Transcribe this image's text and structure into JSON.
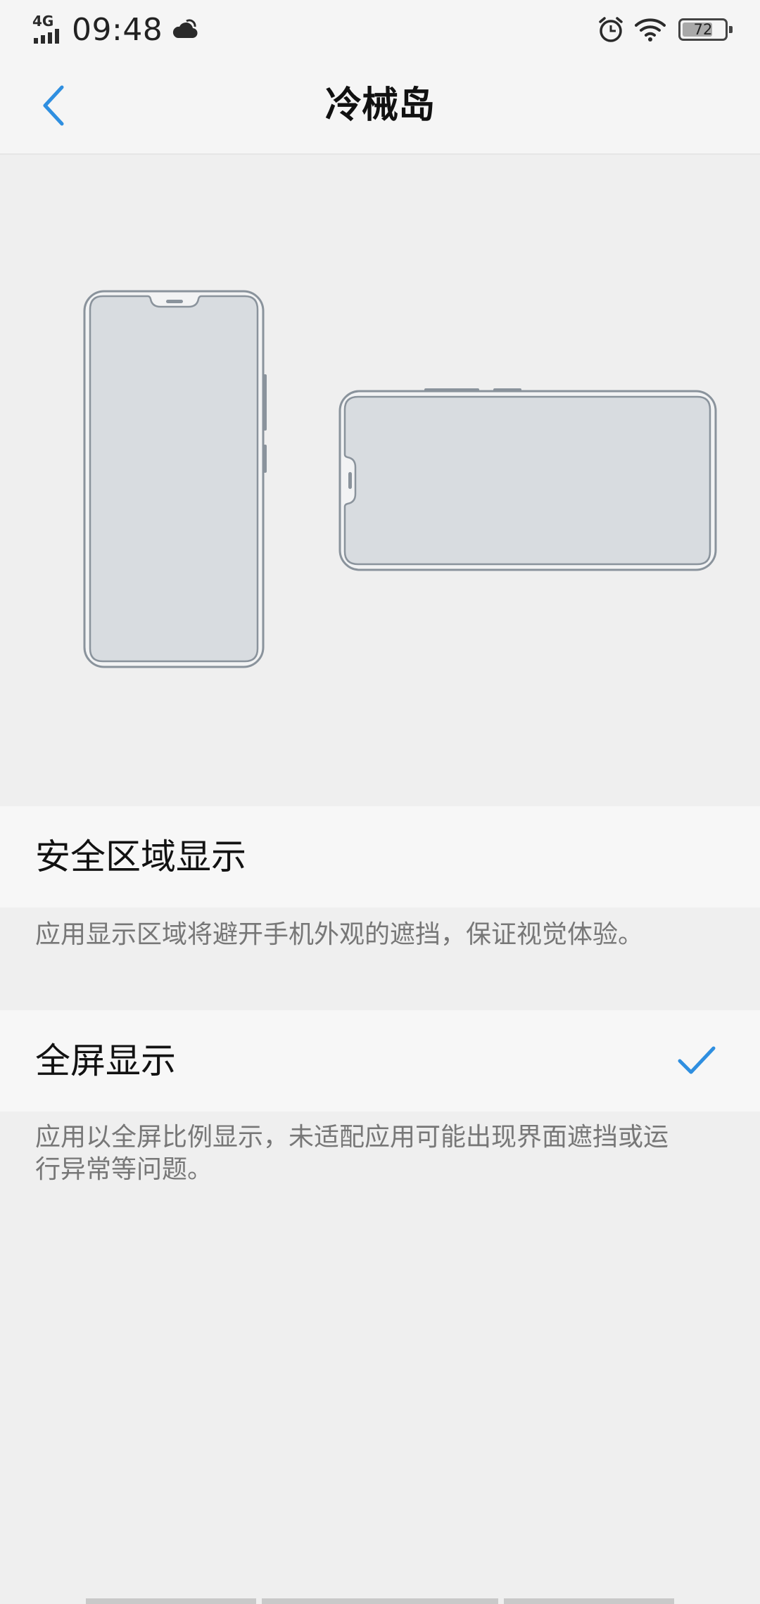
{
  "status_bar": {
    "network": "4G",
    "time": "09:48",
    "battery_level": 72,
    "battery_text": "72",
    "icons": [
      "signal-icon",
      "weather-cloud-icon",
      "alarm-icon",
      "wifi-icon",
      "battery-icon"
    ]
  },
  "app_bar": {
    "title": "冷械岛",
    "back_icon": "chevron-left-icon"
  },
  "options": [
    {
      "label": "安全区域显示",
      "description": "应用显示区域将避开手机外观的遮挡，保证视觉体验。",
      "selected": false
    },
    {
      "label": "全屏显示",
      "description_line1": "应用以全屏比例显示，未适配应用可能出现界面遮挡或运",
      "description_line2": "行异常等问题。",
      "selected": true
    }
  ],
  "colors": {
    "accent": "#2f8fe0",
    "background": "#efefef",
    "row_background": "#f7f7f7",
    "phone_outline": "#8a939c",
    "phone_screen": "#d8dce0"
  }
}
